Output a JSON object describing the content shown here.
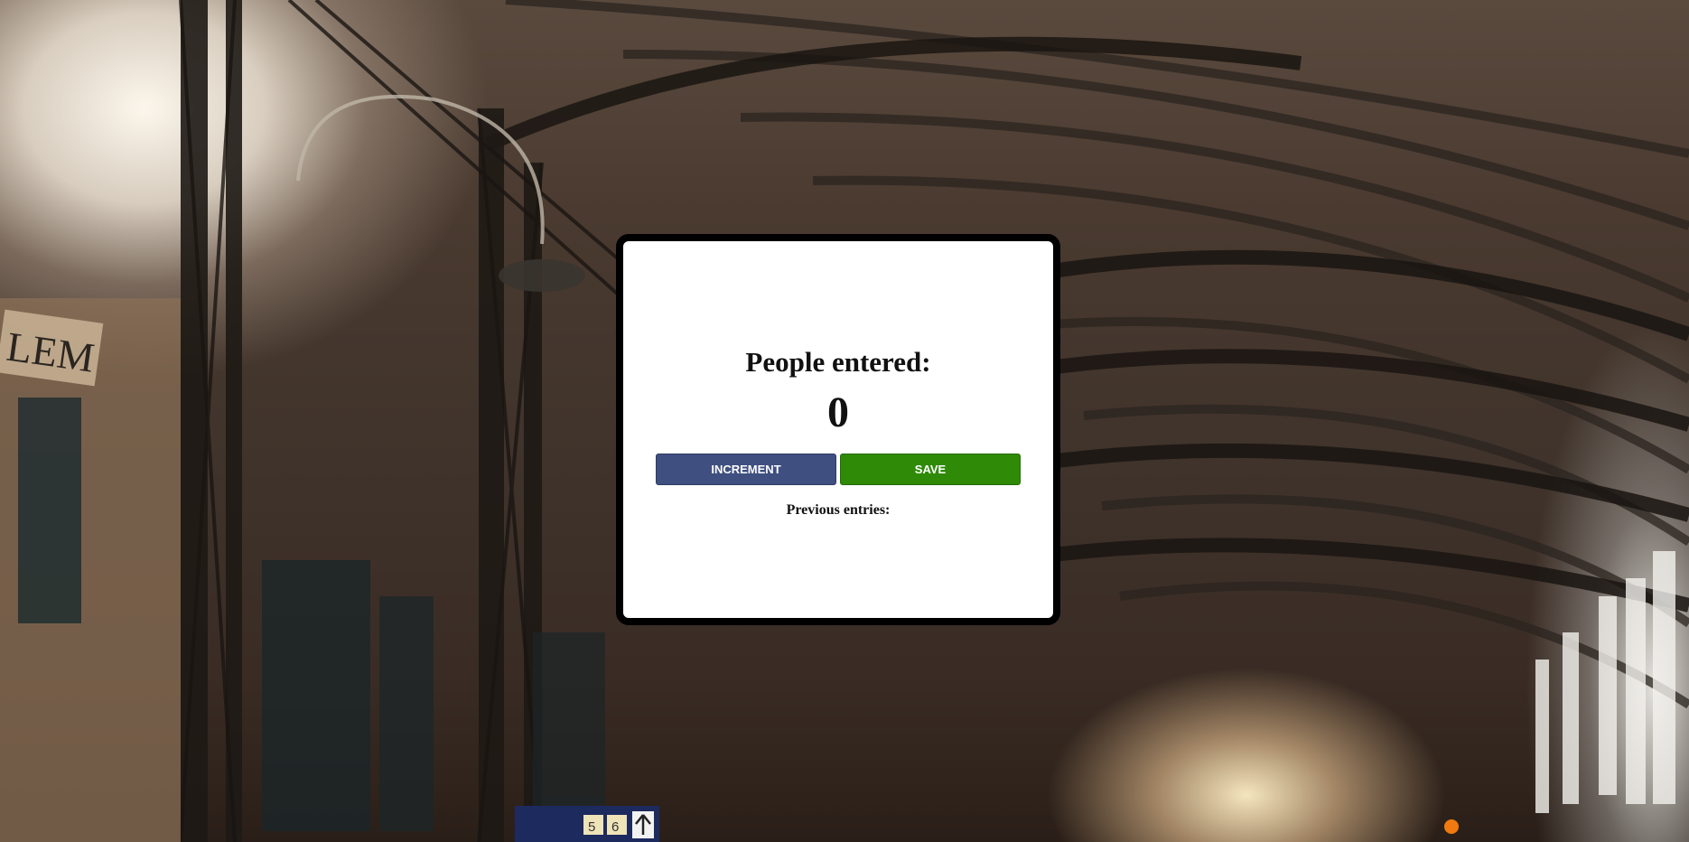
{
  "counter": {
    "heading": "People entered:",
    "count": "0",
    "increment_label": "INCREMENT",
    "save_label": "SAVE",
    "previous_label": "Previous entries:"
  },
  "background": {
    "sign_text": "LEM",
    "platform_numbers": [
      "5",
      "6"
    ]
  },
  "colors": {
    "increment_button": "#3f4f80",
    "save_button": "#2f8a07",
    "card_border": "#000000",
    "card_background": "#ffffff"
  },
  "icons": {
    "platform_arrow": "arrow-up-icon"
  }
}
